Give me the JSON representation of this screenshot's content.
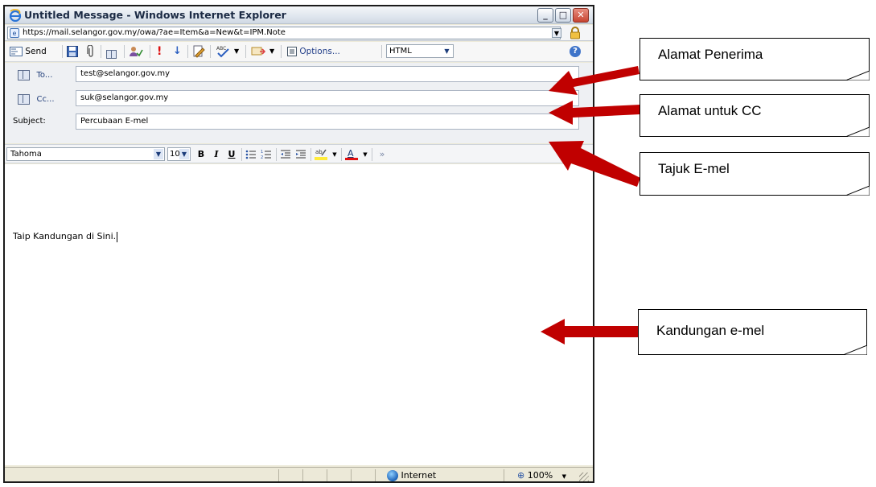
{
  "window": {
    "title": "Untitled Message - Windows Internet Explorer",
    "address": "https://mail.selangor.gov.my/owa/?ae=Item&a=New&t=IPM.Note"
  },
  "toolbar": {
    "send_label": "Send",
    "options_label": "Options...",
    "format_value": "HTML"
  },
  "fields": {
    "to_label": "To...",
    "to_value": "test@selangor.gov.my",
    "cc_label": "Cc...",
    "cc_value": "suk@selangor.gov.my",
    "subject_label": "Subject:",
    "subject_value": "Percubaan E-mel"
  },
  "formatting": {
    "font_value": "Tahoma",
    "size_value": "10"
  },
  "body": {
    "text": "Taip Kandungan di Sini."
  },
  "statusbar": {
    "zone_label": "Internet",
    "zoom_label": "100%"
  },
  "callouts": {
    "recipient": "Alamat Penerima",
    "cc": "Alamat untuk CC",
    "subject": "Tajuk E-mel",
    "body": "Kandungan e-mel"
  },
  "colors": {
    "arrow": "#c00000",
    "titlebar_accent": "#1b2a44"
  }
}
